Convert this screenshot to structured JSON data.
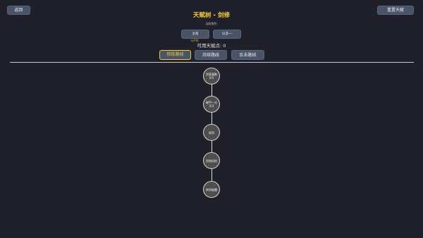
{
  "header": {
    "back_label": "返回",
    "reset_label": "重置天赋",
    "title": "天赋树 - 剑修"
  },
  "role": {
    "label": "当前角色:",
    "main_label": "主角",
    "sub_label": "队友一",
    "tag": "(x74)"
  },
  "talent_points_text": "可用天赋点: 0",
  "tabs": [
    {
      "label": "修炼路线",
      "active": true
    },
    {
      "label": "持续路线",
      "active": false
    },
    {
      "label": "反击路线",
      "active": false
    }
  ],
  "nodes": [
    {
      "name": "剑意凝聚",
      "level": "0/5"
    },
    {
      "name": "破甲一击",
      "level": "0/3"
    },
    {
      "name": "疾剑",
      "level": ""
    },
    {
      "name": "剑指松柏",
      "level": ""
    },
    {
      "name": "神剑破魔",
      "level": ""
    }
  ],
  "colors": {
    "background": "#1f2029",
    "accent": "#f0c83a",
    "button": "#4a5468",
    "node_fill": "#4e4e4e",
    "node_border": "#d4d4d4"
  }
}
